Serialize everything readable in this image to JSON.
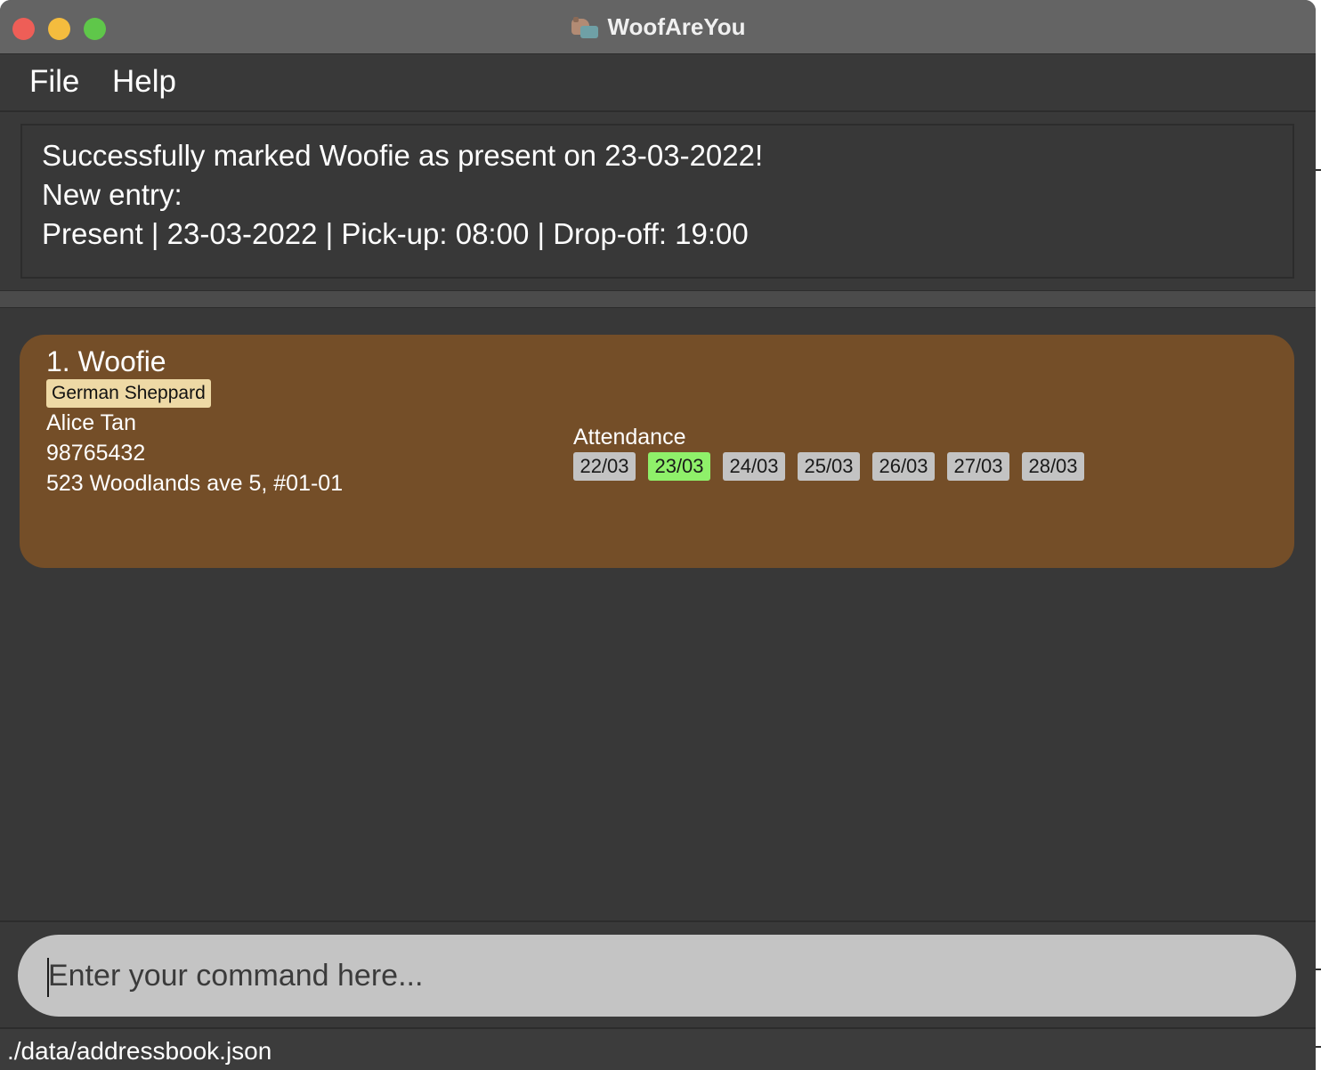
{
  "window": {
    "title": "WoofAreYou"
  },
  "menu": {
    "file": "File",
    "help": "Help"
  },
  "result": {
    "lines": [
      "Successfully marked Woofie as present on 23-03-2022!",
      "New entry:",
      "Present | 23-03-2022 | Pick-up: 08:00 | Drop-off: 19:00"
    ]
  },
  "pets": [
    {
      "index_name": "1.  Woofie",
      "breed": "German Sheppard",
      "owner": "Alice Tan",
      "phone": "98765432",
      "address": "523 Woodlands ave 5, #01-01",
      "attendance_label": "Attendance",
      "attendance": [
        {
          "date": "22/03",
          "present": false
        },
        {
          "date": "23/03",
          "present": true
        },
        {
          "date": "24/03",
          "present": false
        },
        {
          "date": "25/03",
          "present": false
        },
        {
          "date": "26/03",
          "present": false
        },
        {
          "date": "27/03",
          "present": false
        },
        {
          "date": "28/03",
          "present": false
        }
      ]
    }
  ],
  "command": {
    "placeholder": "Enter your command here...",
    "value": ""
  },
  "status": {
    "file_path": "./data/addressbook.json"
  },
  "icons": {
    "app": "dog-app-icon",
    "close": "close-window-icon",
    "minimize": "minimize-window-icon",
    "maximize": "maximize-window-icon"
  },
  "colors": {
    "card_background": "#744e28",
    "breed_tag": "#eed9a5",
    "present_day": "#8ff06a",
    "absent_day": "#c3c3c3",
    "window_background": "#3a3a3a"
  }
}
